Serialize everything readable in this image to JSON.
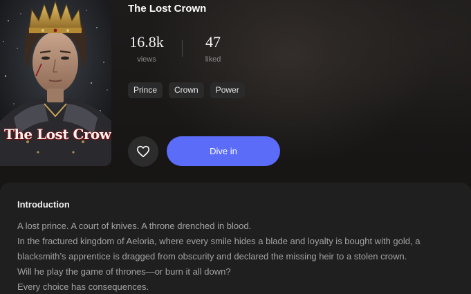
{
  "book": {
    "title": "The Lost Crown",
    "cover_title": "The Lost Crown"
  },
  "stats": {
    "views_value": "16.8k",
    "views_label": "views",
    "liked_value": "47",
    "liked_label": "liked"
  },
  "tags": [
    "Prince",
    "Crown",
    "Power"
  ],
  "actions": {
    "like_icon": "heart-icon",
    "dive_label": "Dive in"
  },
  "intro": {
    "heading": "Introduction",
    "lines": [
      "A lost prince. A court of knives. A throne drenched in blood.",
      "In the fractured kingdom of Aeloria, where every smile hides a blade and loyalty is bought with gold, a",
      "blacksmith’s apprentice is dragged from obscurity and declared the missing heir to a stolen crown.",
      "Will he play the game of thrones—or burn it all down?",
      "Every choice has consequences."
    ]
  },
  "colors": {
    "accent": "#5a6cf8",
    "background": "#141414",
    "card": "#1f1f1f",
    "tag_bg": "#2a2a2a"
  }
}
